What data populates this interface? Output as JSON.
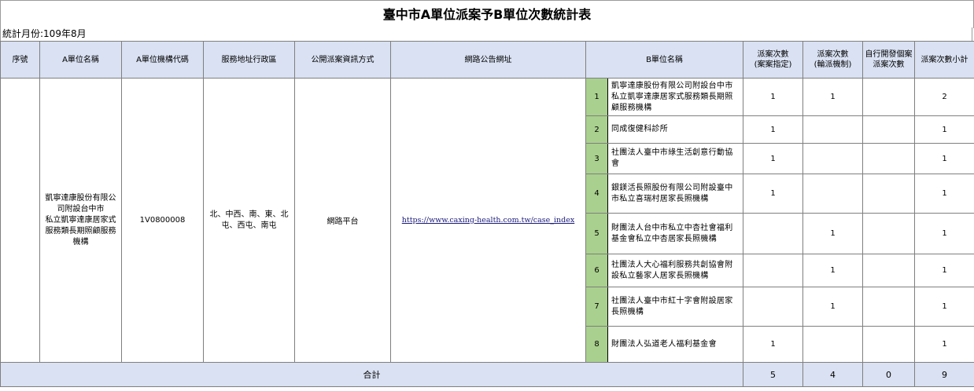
{
  "title": "臺中市A單位派案予B單位次數統計表",
  "period": "統計月份:109年8月",
  "headers": {
    "seq": "序號",
    "a_name": "A單位名稱",
    "a_code": "A單位機構代碼",
    "area": "服務地址行政區",
    "method": "公開派案資訊方式",
    "url": "網路公告網址",
    "b_name": "B單位名稱",
    "assigned": "派案次數\n(案案指定)",
    "rotation": "派案次數\n(輪派機制)",
    "self": "自行開發個案\n派案次數",
    "subtotal": "派案次數小計"
  },
  "a_unit": {
    "seq": "",
    "name": "凱寧達康股份有限公司附設台中市\n私立凱寧達康居家式服務類長期照顧服務機構",
    "code": "1V0800008",
    "area": "北、中西、南、東、北屯、西屯、南屯",
    "method": "網路平台",
    "url": "https://www.caxing-health.com.tw/case_index"
  },
  "rows": [
    {
      "no": "1",
      "name": "凱寧達康股份有限公司附設台中市私立凱寧達康居家式服務類長期照顧服務機構",
      "assigned": "1",
      "rotation": "1",
      "self": "",
      "subtotal": "2"
    },
    {
      "no": "2",
      "name": "同成復健科診所",
      "assigned": "1",
      "rotation": "",
      "self": "",
      "subtotal": "1"
    },
    {
      "no": "3",
      "name": "社團法人臺中市綠生活創意行動協會",
      "assigned": "1",
      "rotation": "",
      "self": "",
      "subtotal": "1"
    },
    {
      "no": "4",
      "name": "銀鎂活長照股份有限公司附設臺中市私立喜瑞村居家長照機構",
      "assigned": "1",
      "rotation": "",
      "self": "",
      "subtotal": "1"
    },
    {
      "no": "5",
      "name": "財團法人台中市私立中杏社會福利基金會私立中杏居家長照機構",
      "assigned": "",
      "rotation": "1",
      "self": "",
      "subtotal": "1"
    },
    {
      "no": "6",
      "name": "社團法人大心福利服務共創協會附設私立藝家人居家長照機構",
      "assigned": "",
      "rotation": "1",
      "self": "",
      "subtotal": "1"
    },
    {
      "no": "7",
      "name": "社團法人臺中市紅十字會附設居家長照機構",
      "assigned": "",
      "rotation": "1",
      "self": "",
      "subtotal": "1"
    },
    {
      "no": "8",
      "name": "財團法人弘道老人福利基金會",
      "assigned": "1",
      "rotation": "",
      "self": "",
      "subtotal": "1"
    }
  ],
  "total": {
    "label": "合計",
    "assigned": "5",
    "rotation": "4",
    "self": "0",
    "subtotal": "9"
  }
}
